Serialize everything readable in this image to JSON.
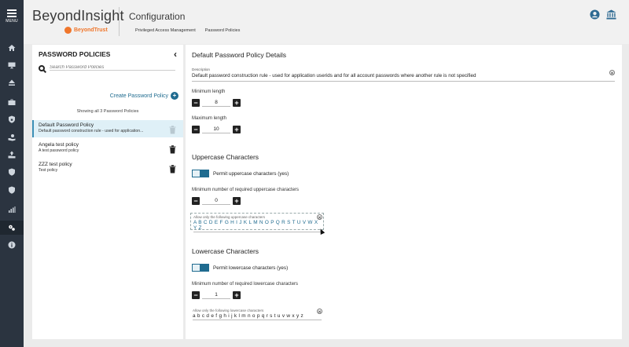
{
  "nav": {
    "menu_label": "MENU",
    "items": [
      "home",
      "monitor",
      "eject",
      "briefcase",
      "shield-lock",
      "hand-coin",
      "hand-up",
      "shield-check",
      "shield-badge",
      "bar-chart",
      "gears",
      "info"
    ]
  },
  "header": {
    "brand": "BeyondInsight",
    "vendor": "BeyondTrust",
    "title": "Configuration",
    "breadcrumbs": [
      "Privileged Access Management",
      "Password Policies"
    ]
  },
  "left": {
    "title": "PASSWORD POLICIES",
    "search_placeholder": "Search Password Policies",
    "create_label": "Create Password Policy",
    "showing_text": "Showing all 3 Password Policies",
    "policies": [
      {
        "name": "Default Password Policy",
        "desc": "Default password construction rule - used for application..."
      },
      {
        "name": "Angela test policy",
        "desc": "A test password policy"
      },
      {
        "name": "ZZZ test policy",
        "desc": "Test policy"
      }
    ]
  },
  "details": {
    "title": "Default Password Policy Details",
    "description_label": "Description",
    "description_value": "Default password construction rule - used for application userids and for all account passwords where another rule is not specified",
    "min_length_label": "Minimum length",
    "min_length": "8",
    "max_length_label": "Maximum length",
    "max_length": "10",
    "uppercase": {
      "heading": "Uppercase Characters",
      "toggle_label": "Permit uppercase characters (yes)",
      "min_label": "Minimum number of required uppercase characters",
      "min_value": "0",
      "allow_caption": "Allow only the following uppercase characters",
      "allowed": "A B C D E F G H I J K L M N O P Q R S T U V W X Y Z"
    },
    "lowercase": {
      "heading": "Lowercase Characters",
      "toggle_label": "Permit lowercase characters (yes)",
      "min_label": "Minimum number of required lowercase characters",
      "min_value": "1",
      "allow_caption": "Allow only the following lowercase characters",
      "allowed": "a b c d e f g h i j k l m n o p q r s t u v w x y z"
    },
    "stepper_minus": "−",
    "stepper_plus": "+"
  },
  "colors": {
    "accent": "#1f6b8f",
    "rail": "#2b3440",
    "brand_orange": "#f0762b"
  }
}
